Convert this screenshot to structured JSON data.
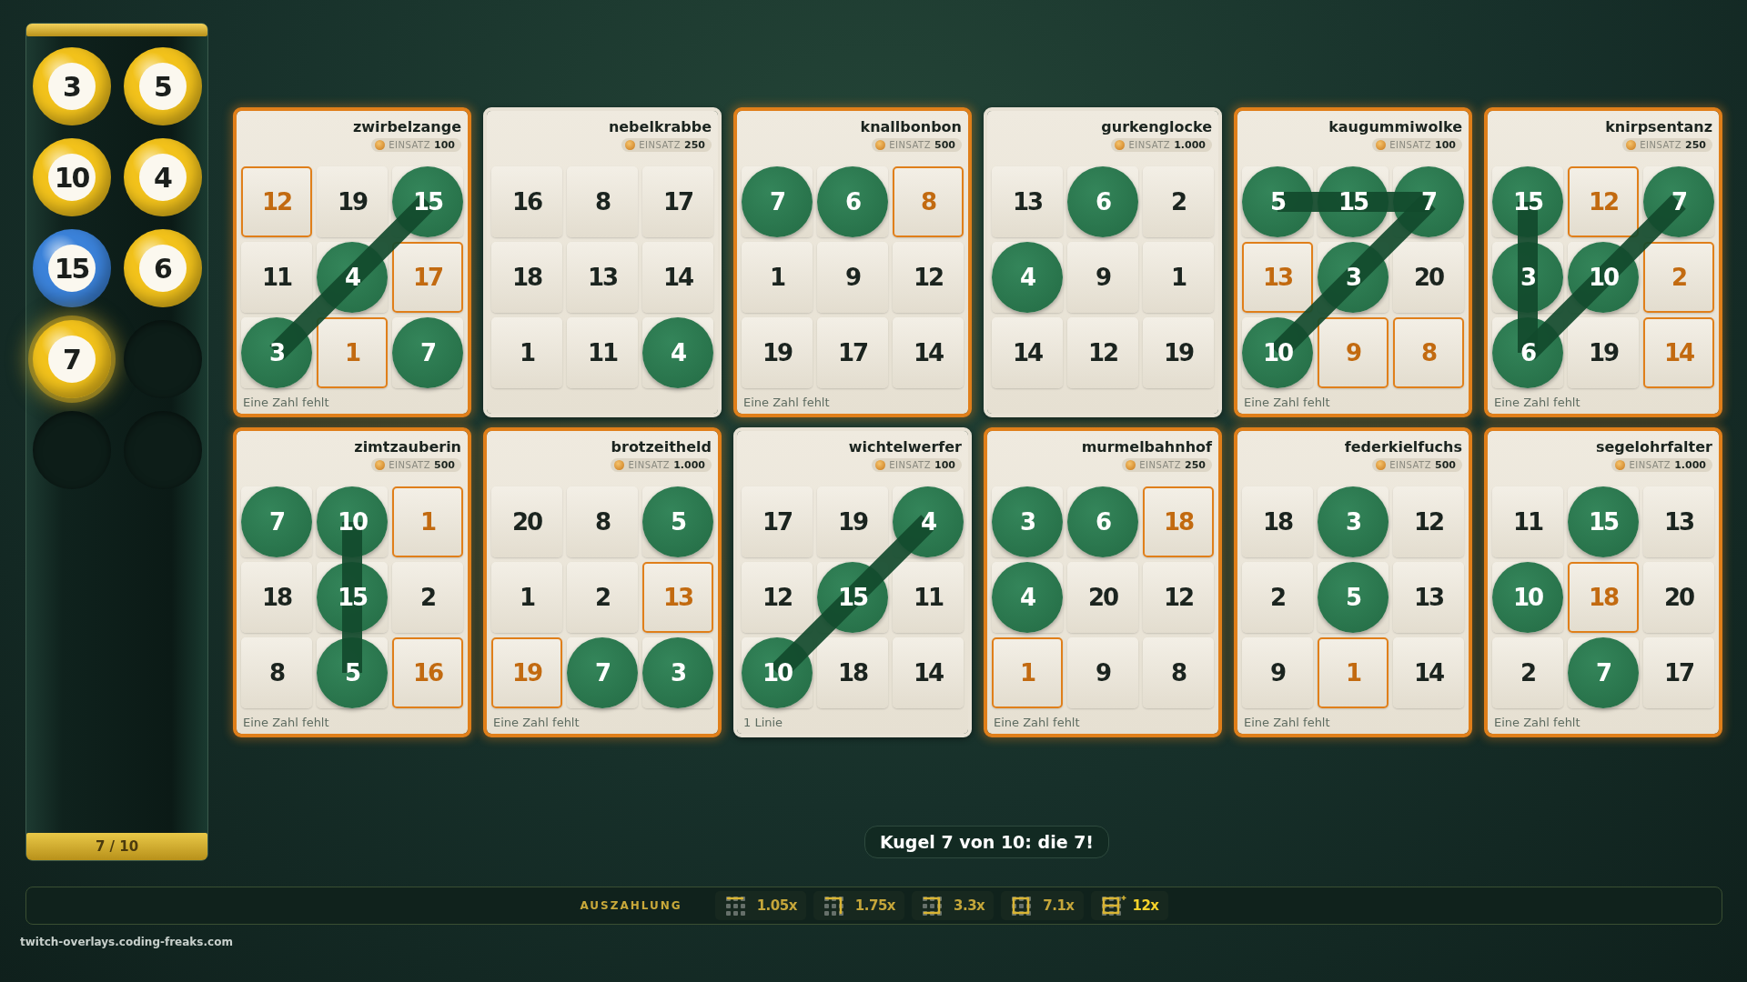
{
  "balls": [
    {
      "kind": "ball",
      "number": "3",
      "color": "#f2c21b",
      "selected": false
    },
    {
      "kind": "ball",
      "number": "5",
      "color": "#f2c21b",
      "selected": false
    },
    {
      "kind": "ball",
      "number": "10",
      "color": "#f2c21b",
      "selected": false
    },
    {
      "kind": "ball",
      "number": "4",
      "color": "#f2c21b",
      "selected": false
    },
    {
      "kind": "ball",
      "number": "15",
      "color": "#3b82d9",
      "selected": false
    },
    {
      "kind": "ball",
      "number": "6",
      "color": "#f2c21b",
      "selected": false
    },
    {
      "kind": "ball",
      "number": "7",
      "color": "#f2c21b",
      "selected": true
    },
    {
      "kind": "empty"
    },
    {
      "kind": "empty"
    },
    {
      "kind": "empty"
    }
  ],
  "counter": "7 / 10",
  "cards": [
    {
      "name": "zwirbelzange",
      "stake_label": "EINSATZ",
      "stake": "100",
      "highlighted": true,
      "status": "Eine Zahl fehlt",
      "lines": [
        {
          "kind": "diagonal"
        }
      ],
      "cells": [
        {
          "n": "12",
          "marked": false,
          "missing": true
        },
        {
          "n": "19",
          "marked": false,
          "missing": false
        },
        {
          "n": "15",
          "marked": true,
          "missing": false
        },
        {
          "n": "11",
          "marked": false,
          "missing": false
        },
        {
          "n": "4",
          "marked": true,
          "missing": false
        },
        {
          "n": "17",
          "marked": false,
          "missing": true
        },
        {
          "n": "3",
          "marked": true,
          "missing": false
        },
        {
          "n": "1",
          "marked": false,
          "missing": true
        },
        {
          "n": "7",
          "marked": true,
          "missing": false
        }
      ]
    },
    {
      "name": "nebelkrabbe",
      "stake_label": "EINSATZ",
      "stake": "250",
      "highlighted": false,
      "cells": [
        {
          "n": "16",
          "marked": false,
          "missing": false
        },
        {
          "n": "8",
          "marked": false,
          "missing": false
        },
        {
          "n": "17",
          "marked": false,
          "missing": false
        },
        {
          "n": "18",
          "marked": false,
          "missing": false
        },
        {
          "n": "13",
          "marked": false,
          "missing": false
        },
        {
          "n": "14",
          "marked": false,
          "missing": false
        },
        {
          "n": "1",
          "marked": false,
          "missing": false
        },
        {
          "n": "11",
          "marked": false,
          "missing": false
        },
        {
          "n": "4",
          "marked": true,
          "missing": false
        }
      ]
    },
    {
      "name": "knallbonbon",
      "stake_label": "EINSATZ",
      "stake": "500",
      "highlighted": true,
      "status": "Eine Zahl fehlt",
      "cells": [
        {
          "n": "7",
          "marked": true,
          "missing": false
        },
        {
          "n": "6",
          "marked": true,
          "missing": false
        },
        {
          "n": "8",
          "marked": false,
          "missing": true
        },
        {
          "n": "1",
          "marked": false,
          "missing": false
        },
        {
          "n": "9",
          "marked": false,
          "missing": false
        },
        {
          "n": "12",
          "marked": false,
          "missing": false
        },
        {
          "n": "19",
          "marked": false,
          "missing": false
        },
        {
          "n": "17",
          "marked": false,
          "missing": false
        },
        {
          "n": "14",
          "marked": false,
          "missing": false
        }
      ]
    },
    {
      "name": "gurkenglocke",
      "stake_label": "EINSATZ",
      "stake": "1.000",
      "highlighted": false,
      "cells": [
        {
          "n": "13",
          "marked": false,
          "missing": false
        },
        {
          "n": "6",
          "marked": true,
          "missing": false
        },
        {
          "n": "2",
          "marked": false,
          "missing": false
        },
        {
          "n": "4",
          "marked": true,
          "missing": false
        },
        {
          "n": "9",
          "marked": false,
          "missing": false
        },
        {
          "n": "1",
          "marked": false,
          "missing": false
        },
        {
          "n": "14",
          "marked": false,
          "missing": false
        },
        {
          "n": "12",
          "marked": false,
          "missing": false
        },
        {
          "n": "19",
          "marked": false,
          "missing": false
        }
      ]
    },
    {
      "name": "kaugummiwolke",
      "stake_label": "EINSATZ",
      "stake": "100",
      "highlighted": true,
      "status": "Eine Zahl fehlt",
      "lines": [
        {
          "kind": "toprow"
        },
        {
          "kind": "diagonal"
        }
      ],
      "cells": [
        {
          "n": "5",
          "marked": true,
          "missing": false
        },
        {
          "n": "15",
          "marked": true,
          "missing": false
        },
        {
          "n": "7",
          "marked": true,
          "missing": false
        },
        {
          "n": "13",
          "marked": false,
          "missing": true
        },
        {
          "n": "3",
          "marked": true,
          "missing": false
        },
        {
          "n": "20",
          "marked": false,
          "missing": false
        },
        {
          "n": "10",
          "marked": true,
          "missing": false
        },
        {
          "n": "9",
          "marked": false,
          "missing": true
        },
        {
          "n": "8",
          "marked": false,
          "missing": true
        }
      ]
    },
    {
      "name": "knirpsentanz",
      "stake_label": "EINSATZ",
      "stake": "250",
      "highlighted": true,
      "status": "Eine Zahl fehlt",
      "lines": [
        {
          "kind": "leftcolumn"
        },
        {
          "kind": "diagonal"
        }
      ],
      "cells": [
        {
          "n": "15",
          "marked": true,
          "missing": false
        },
        {
          "n": "12",
          "marked": false,
          "missing": true
        },
        {
          "n": "7",
          "marked": true,
          "missing": false
        },
        {
          "n": "3",
          "marked": true,
          "missing": false
        },
        {
          "n": "10",
          "marked": true,
          "missing": false
        },
        {
          "n": "2",
          "marked": false,
          "missing": true
        },
        {
          "n": "6",
          "marked": true,
          "missing": false
        },
        {
          "n": "19",
          "marked": false,
          "missing": false
        },
        {
          "n": "14",
          "marked": false,
          "missing": true
        }
      ]
    },
    {
      "name": "zimtzauberin",
      "stake_label": "EINSATZ",
      "stake": "500",
      "highlighted": true,
      "status": "Eine Zahl fehlt",
      "lines": [
        {
          "kind": "middlecolumn"
        }
      ],
      "cells": [
        {
          "n": "7",
          "marked": true,
          "missing": false
        },
        {
          "n": "10",
          "marked": true,
          "missing": false
        },
        {
          "n": "1",
          "marked": false,
          "missing": true
        },
        {
          "n": "18",
          "marked": false,
          "missing": false
        },
        {
          "n": "15",
          "marked": true,
          "missing": false
        },
        {
          "n": "2",
          "marked": false,
          "missing": false
        },
        {
          "n": "8",
          "marked": false,
          "missing": false
        },
        {
          "n": "5",
          "marked": true,
          "missing": false
        },
        {
          "n": "16",
          "marked": false,
          "missing": true
        }
      ]
    },
    {
      "name": "brotzeitheld",
      "stake_label": "EINSATZ",
      "stake": "1.000",
      "highlighted": true,
      "status": "Eine Zahl fehlt",
      "cells": [
        {
          "n": "20",
          "marked": false,
          "missing": false
        },
        {
          "n": "8",
          "marked": false,
          "missing": false
        },
        {
          "n": "5",
          "marked": true,
          "missing": false
        },
        {
          "n": "1",
          "marked": false,
          "missing": false
        },
        {
          "n": "2",
          "marked": false,
          "missing": false
        },
        {
          "n": "13",
          "marked": false,
          "missing": true
        },
        {
          "n": "19",
          "marked": false,
          "missing": true
        },
        {
          "n": "7",
          "marked": true,
          "missing": false
        },
        {
          "n": "3",
          "marked": true,
          "missing": false
        }
      ]
    },
    {
      "name": "wichtelwerfer",
      "stake_label": "EINSATZ",
      "stake": "100",
      "highlighted": false,
      "status": "1 Linie",
      "lines": [
        {
          "kind": "diagonal"
        }
      ],
      "cells": [
        {
          "n": "17",
          "marked": false,
          "missing": false
        },
        {
          "n": "19",
          "marked": false,
          "missing": false
        },
        {
          "n": "4",
          "marked": true,
          "missing": false
        },
        {
          "n": "12",
          "marked": false,
          "missing": false
        },
        {
          "n": "15",
          "marked": true,
          "missing": false
        },
        {
          "n": "11",
          "marked": false,
          "missing": false
        },
        {
          "n": "10",
          "marked": true,
          "missing": false
        },
        {
          "n": "18",
          "marked": false,
          "missing": false
        },
        {
          "n": "14",
          "marked": false,
          "missing": false
        }
      ]
    },
    {
      "name": "murmelbahnhof",
      "stake_label": "EINSATZ",
      "stake": "250",
      "highlighted": true,
      "status": "Eine Zahl fehlt",
      "cells": [
        {
          "n": "3",
          "marked": true,
          "missing": false
        },
        {
          "n": "6",
          "marked": true,
          "missing": false
        },
        {
          "n": "18",
          "marked": false,
          "missing": true
        },
        {
          "n": "4",
          "marked": true,
          "missing": false
        },
        {
          "n": "20",
          "marked": false,
          "missing": false
        },
        {
          "n": "12",
          "marked": false,
          "missing": false
        },
        {
          "n": "1",
          "marked": false,
          "missing": true
        },
        {
          "n": "9",
          "marked": false,
          "missing": false
        },
        {
          "n": "8",
          "marked": false,
          "missing": false
        }
      ]
    },
    {
      "name": "federkielfuchs",
      "stake_label": "EINSATZ",
      "stake": "500",
      "highlighted": true,
      "status": "Eine Zahl fehlt",
      "cells": [
        {
          "n": "18",
          "marked": false,
          "missing": false
        },
        {
          "n": "3",
          "marked": true,
          "missing": false
        },
        {
          "n": "12",
          "marked": false,
          "missing": false
        },
        {
          "n": "2",
          "marked": false,
          "missing": false
        },
        {
          "n": "5",
          "marked": true,
          "missing": false
        },
        {
          "n": "13",
          "marked": false,
          "missing": false
        },
        {
          "n": "9",
          "marked": false,
          "missing": false
        },
        {
          "n": "1",
          "marked": false,
          "missing": true
        },
        {
          "n": "14",
          "marked": false,
          "missing": false
        }
      ]
    },
    {
      "name": "segelohrfalter",
      "stake_label": "EINSATZ",
      "stake": "1.000",
      "highlighted": true,
      "status": "Eine Zahl fehlt",
      "cells": [
        {
          "n": "11",
          "marked": false,
          "missing": false
        },
        {
          "n": "15",
          "marked": true,
          "missing": false
        },
        {
          "n": "13",
          "marked": false,
          "missing": false
        },
        {
          "n": "10",
          "marked": true,
          "missing": false
        },
        {
          "n": "18",
          "marked": false,
          "missing": true
        },
        {
          "n": "20",
          "marked": false,
          "missing": false
        },
        {
          "n": "2",
          "marked": false,
          "missing": false
        },
        {
          "n": "7",
          "marked": true,
          "missing": false
        },
        {
          "n": "17",
          "marked": false,
          "missing": false
        }
      ]
    }
  ],
  "announcement": "Kugel 7 von 10: die 7!",
  "payout": {
    "label": "AUSZAHLUNG",
    "tiers": [
      {
        "kind": "line1",
        "multiplier": "1.05x",
        "selected": false
      },
      {
        "kind": "line2",
        "multiplier": "1.75x",
        "selected": false
      },
      {
        "kind": "line3",
        "multiplier": "3.3x",
        "selected": false
      },
      {
        "kind": "line4",
        "multiplier": "7.1x",
        "selected": false
      },
      {
        "kind": "full",
        "multiplier": "12x",
        "selected": true
      }
    ]
  },
  "footer": "twitch-overlays.coding-freaks.com"
}
